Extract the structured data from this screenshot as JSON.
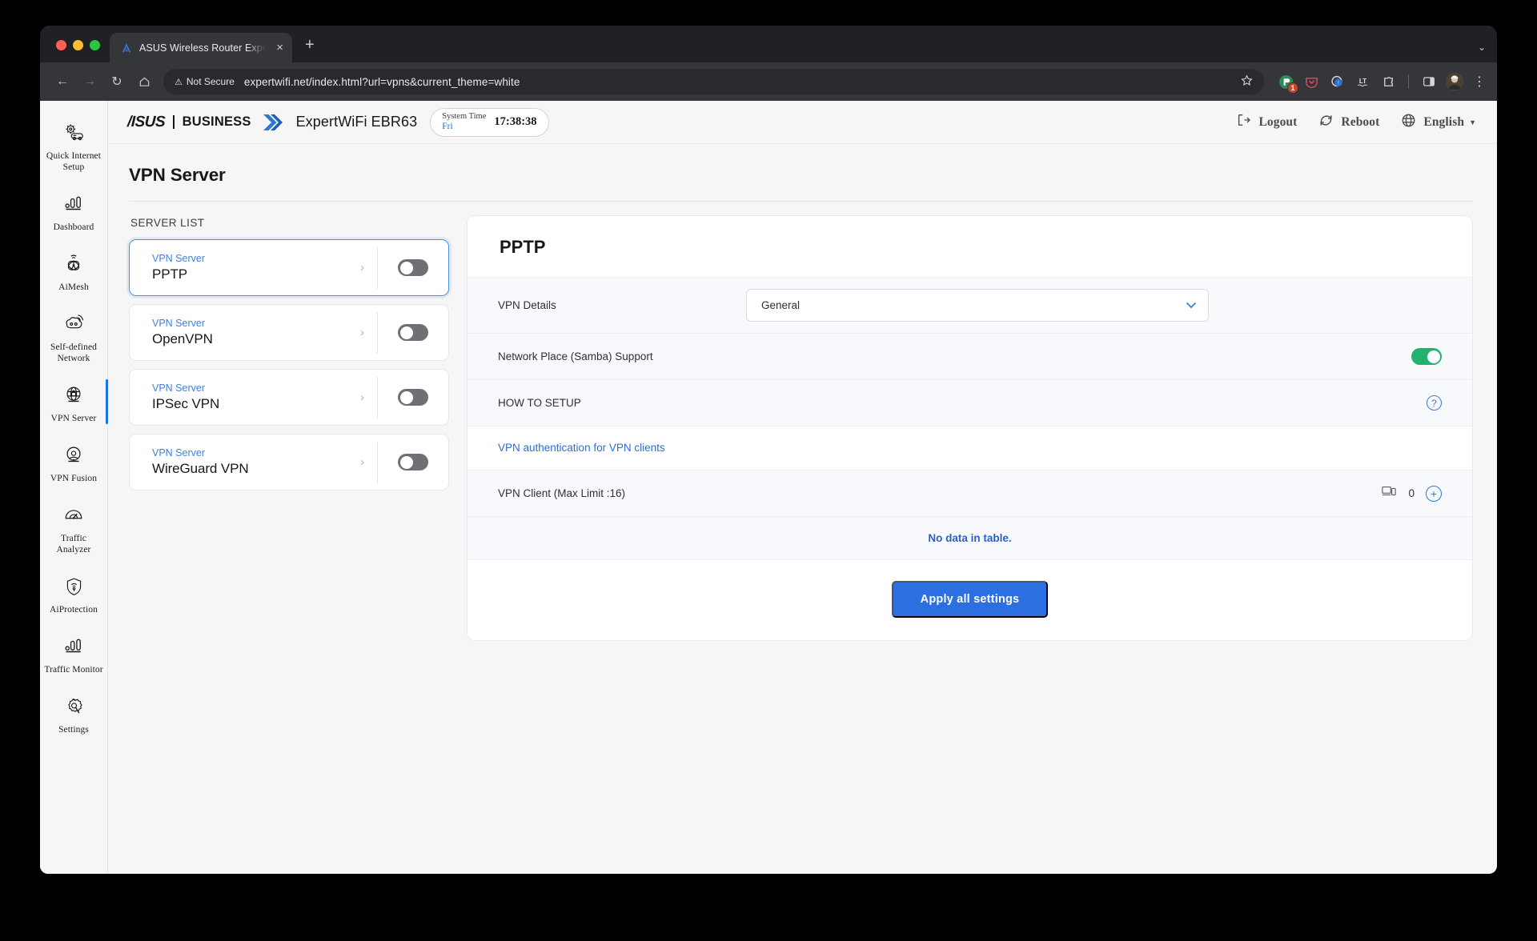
{
  "browser": {
    "tab": {
      "title": "ASUS Wireless Router Exper",
      "favicon": "asus-logo-icon",
      "close": "×"
    },
    "new_tab": "+",
    "tabstrip_menu": "⌄",
    "nav": {
      "back": "←",
      "forward": "→",
      "reload": "↻",
      "home": "⌂"
    },
    "omnibox": {
      "security_label": "Not Secure",
      "security_icon": "warning-triangle-icon",
      "url": "expertwifi.net/index.html?url=vpns&current_theme=white",
      "bookmark_icon": "star-icon"
    },
    "extensions": [
      {
        "name": "extension-green-icon",
        "badge": "1"
      },
      {
        "name": "pocket-icon",
        "badge": ""
      },
      {
        "name": "extension-blue-icon",
        "badge": ""
      },
      {
        "name": "languagetool-icon",
        "badge": ""
      },
      {
        "name": "extensions-puzzle-icon",
        "badge": ""
      }
    ],
    "side_panel_icon": "side-panel-icon",
    "profile_icon": "avatar",
    "menu_icon": "kebab-menu-icon"
  },
  "sidebar": {
    "items": [
      {
        "label": "Quick Internet Setup",
        "icon": "quick-internet-setup-icon",
        "active": false
      },
      {
        "label": "Dashboard",
        "icon": "dashboard-icon",
        "active": false
      },
      {
        "label": "AiMesh",
        "icon": "aimesh-icon",
        "active": false
      },
      {
        "label": "Self-defined Network",
        "icon": "self-defined-network-icon",
        "active": false
      },
      {
        "label": "VPN Server",
        "icon": "vpn-server-icon",
        "active": true
      },
      {
        "label": "VPN Fusion",
        "icon": "vpn-fusion-icon",
        "active": false
      },
      {
        "label": "Traffic Analyzer",
        "icon": "traffic-analyzer-icon",
        "active": false
      },
      {
        "label": "AiProtection",
        "icon": "aiprotection-icon",
        "active": false
      },
      {
        "label": "Traffic Monitor",
        "icon": "traffic-monitor-icon",
        "active": false
      },
      {
        "label": "Settings",
        "icon": "settings-gear-icon",
        "active": false
      }
    ]
  },
  "header": {
    "brand": "/ISUS",
    "brand_suffix": "BUSINESS",
    "model": "ExpertWiFi EBR63",
    "system_time_label": "System Time",
    "system_time_day": "Fri",
    "system_time_clock": "17:38:38",
    "logout": "Logout",
    "reboot": "Reboot",
    "language": "English",
    "language_caret": "▼"
  },
  "page": {
    "title": "VPN Server",
    "server_list_label": "SERVER LIST",
    "servers": [
      {
        "sub": "VPN Server",
        "name": "PPTP",
        "enabled": false,
        "selected": true
      },
      {
        "sub": "VPN Server",
        "name": "OpenVPN",
        "enabled": false,
        "selected": false
      },
      {
        "sub": "VPN Server",
        "name": "IPSec VPN",
        "enabled": false,
        "selected": false
      },
      {
        "sub": "VPN Server",
        "name": "WireGuard VPN",
        "enabled": false,
        "selected": false
      }
    ],
    "panel": {
      "title": "PPTP",
      "vpn_details_label": "VPN Details",
      "vpn_details_value": "General",
      "samba_label": "Network Place (Samba) Support",
      "samba_enabled": true,
      "how_to_setup_label": "HOW TO SETUP",
      "help_icon": "question-mark-icon",
      "auth_link": "VPN authentication for VPN clients",
      "vpn_client_label": "VPN Client (Max Limit :16)",
      "vpn_client_count": "0",
      "client_icon": "device-monitor-icon",
      "add_icon": "plus-circle-icon",
      "no_data": "No data in table.",
      "apply_label": "Apply all settings"
    }
  },
  "colors": {
    "accent_blue": "#2c6fe0",
    "link_blue": "#2b6fd4",
    "toggle_on_green": "#23b26d",
    "toggle_off_gray": "#6e7075",
    "page_bg": "#f6f6f7"
  }
}
